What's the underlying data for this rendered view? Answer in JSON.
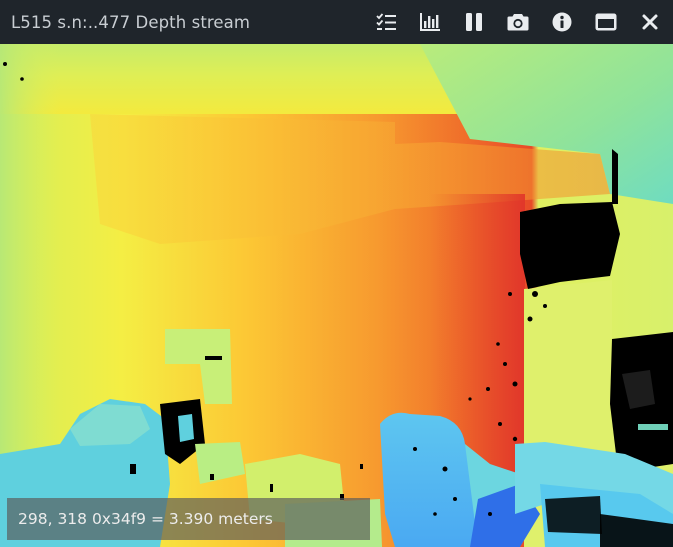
{
  "window": {
    "title": "L515 s.n:..477 Depth stream"
  },
  "toolbar": {
    "buttons": [
      {
        "name": "options-button",
        "icon": "checklist-icon"
      },
      {
        "name": "metrics-button",
        "icon": "bar-chart-icon"
      },
      {
        "name": "pause-button",
        "icon": "pause-icon"
      },
      {
        "name": "snapshot-button",
        "icon": "camera-icon"
      },
      {
        "name": "info-button",
        "icon": "info-icon"
      },
      {
        "name": "maximize-button",
        "icon": "window-maximize-icon"
      },
      {
        "name": "close-button",
        "icon": "close-icon"
      }
    ],
    "icon_color": "#e9ecef"
  },
  "stream": {
    "colormap": "jet",
    "readout": "298, 318 0x34f9 = 3.390 meters"
  },
  "colors": {
    "titlebar_bg": "#1f252b",
    "title_text": "#c9ced3",
    "no_data": "#000000"
  }
}
